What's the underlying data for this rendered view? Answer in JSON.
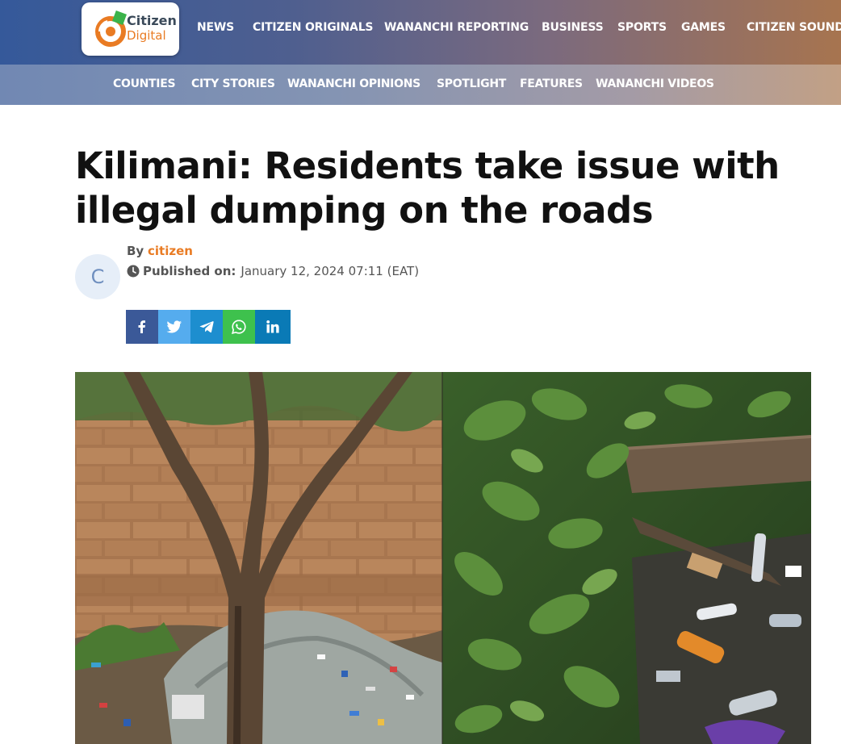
{
  "header": {
    "logo": {
      "line1": "Citizen",
      "line2": "Digital"
    },
    "nav": [
      "NEWS",
      "CITIZEN ORIGINALS",
      "WANANCHI REPORTING",
      "BUSINESS",
      "SPORTS",
      "GAMES",
      "CITIZEN SOUNDS"
    ],
    "subnav": [
      "COUNTIES",
      "CITY STORIES",
      "WANANCHI OPINIONS",
      "SPOTLIGHT",
      "FEATURES",
      "WANANCHI VIDEOS"
    ]
  },
  "article": {
    "title": "Kilimani: Residents take issue with illegal dumping on the roads",
    "avatar_letter": "C",
    "by_label": "By",
    "author": "citizen",
    "published_label": "Published on:",
    "published_date": "January 12, 2024 07:11 (EAT)"
  },
  "share": {
    "buttons": [
      {
        "icon": "facebook-icon",
        "color": "#3b5998"
      },
      {
        "icon": "twitter-icon",
        "color": "#55acee"
      },
      {
        "icon": "telegram-icon",
        "color": "#1d8ecf"
      },
      {
        "icon": "whatsapp-icon",
        "color": "#3ec14d"
      },
      {
        "icon": "linkedin-icon",
        "color": "#0a7ab6"
      }
    ]
  },
  "colors": {
    "accent": "#e97b23",
    "nav_bg_start": "#35599a",
    "nav_bg_end": "#a7744f"
  }
}
